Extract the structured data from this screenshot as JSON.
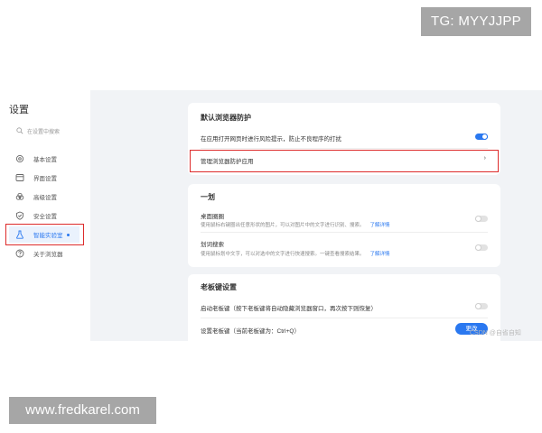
{
  "overlays": {
    "top_badge": "TG: MYYJJPP",
    "bottom_badge": "www.fredkarel.com"
  },
  "sidebar": {
    "title": "设置",
    "search_placeholder": "在设置中搜索",
    "items": [
      {
        "label": "基本设置",
        "icon": "gear-icon"
      },
      {
        "label": "界面设置",
        "icon": "window-icon"
      },
      {
        "label": "高级设置",
        "icon": "cloud-icon"
      },
      {
        "label": "安全设置",
        "icon": "shield-icon"
      },
      {
        "label": "智能实验室",
        "icon": "flask-icon",
        "active": true
      },
      {
        "label": "关于浏览器",
        "icon": "question-icon"
      }
    ]
  },
  "sections": {
    "default_browser": {
      "title": "默认浏览器防护",
      "open_risk_label": "在应用打开网页时进行风险提示，防止不良程序的打扰",
      "open_risk_enabled": true,
      "manage_label": "管理浏览器防护应用"
    },
    "yihua": {
      "title": "一划",
      "desktop": {
        "label": "桌面圈圈",
        "desc": "使用鼠标右键圈出任意形状的图片，可以对图片中的文字进行识别、搜索。",
        "link": "了解详情",
        "enabled": false
      },
      "search": {
        "label": "划词搜索",
        "desc": "使用鼠标划中文字，可以对选中的文字进行快速搜索。一键查看搜索结果。",
        "link": "了解详情",
        "enabled": false
      }
    },
    "boss_key": {
      "title": "老板键设置",
      "enable_label": "启动老板键（按下老板键将自动隐藏浏览器窗口，再次按下则恢复）",
      "enabled": false,
      "set_label": "设置老板键（当前老板键为：Ctrl+Q）",
      "change_button": "更改"
    }
  },
  "watermark": "CSDN @自省自知",
  "colors": {
    "accent": "#2a78f0",
    "highlight": "#dd2b2b",
    "background": "#f1f3f6"
  }
}
